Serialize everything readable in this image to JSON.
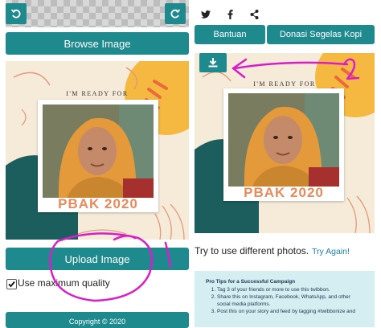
{
  "left": {
    "browse_label": "Browse Image",
    "upload_label": "Upload Image",
    "checkbox_label": "Use maximum quality",
    "checkbox_checked": true,
    "footer_text": "Copyright © 2020"
  },
  "twibbon": {
    "tagline": "I'M READY FOR",
    "title": "PBAK 2020"
  },
  "right": {
    "share_icons": [
      "twitter-icon",
      "facebook-icon",
      "share-icon"
    ],
    "bantuan_label": "Bantuan",
    "donasi_label": "Donasi Segelas Kopi",
    "retry_prompt": "Try to use different photos.",
    "retry_link": "Try Again!",
    "tips_title": "Pro Tips for a Successful Campaign",
    "tips": [
      "Tag 3 of your friends or more to use this twibbon.",
      "Share this on Instagram, Facebook, WhatsApp, and other social media platforms.",
      "Post this on your story and feed by tagging #twibbonize and"
    ]
  },
  "colors": {
    "teal": "#1e8a8e",
    "annotation": "#d81ec8",
    "link": "#1e7fa8"
  }
}
